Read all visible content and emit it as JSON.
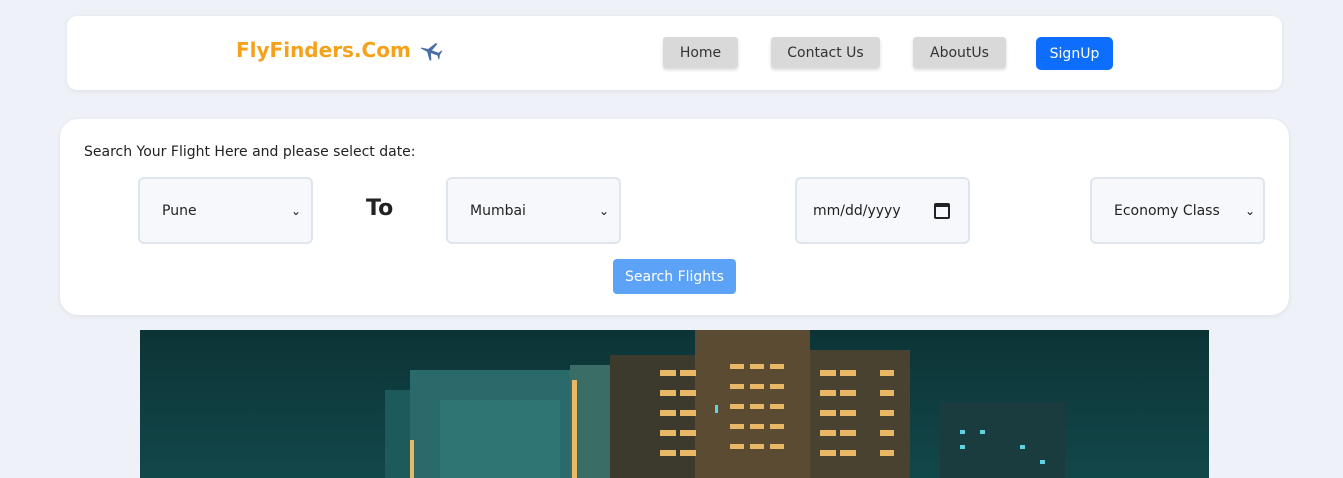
{
  "navbar": {
    "brand": "FlyFinders.Com",
    "brand_icon": "airplane-icon",
    "items": [
      {
        "label": "Home"
      },
      {
        "label": "Contact Us"
      },
      {
        "label": "AboutUs"
      }
    ],
    "signup_label": "SignUp"
  },
  "search": {
    "prompt": "Search Your Flight Here and please select date:",
    "from": "Pune",
    "to_label": "To",
    "destination": "Mumbai",
    "date_placeholder": "mm/dd/yyyy",
    "class": "Economy Class",
    "submit_label": "Search Flights"
  },
  "colors": {
    "brand": "#f5a21a",
    "signup": "#0d6efd",
    "search_button": "#5ca3f7",
    "background": "#eef1f7"
  }
}
